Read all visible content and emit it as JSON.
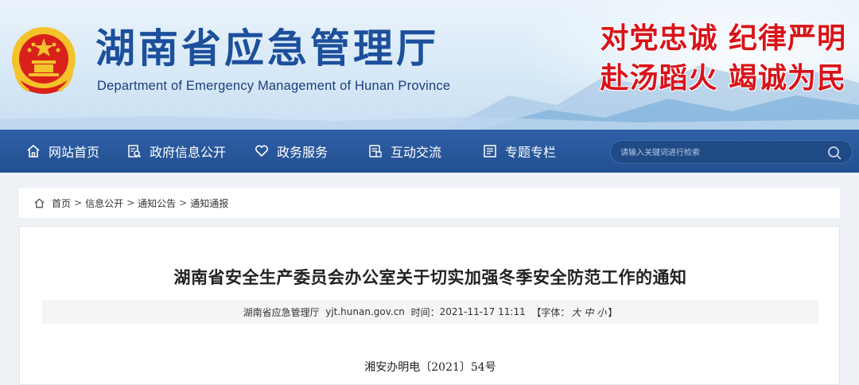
{
  "header": {
    "title": "湖南省应急管理厅",
    "subtitle": "Department of Emergency Management of Hunan Province",
    "slogan_line1": "对党忠诚 纪律严明",
    "slogan_line2": "赴汤蹈火 竭诚为民",
    "colors": {
      "title": "#1c4f9c",
      "slogan": "#d7141a",
      "nav": "#2a589d"
    }
  },
  "nav": {
    "items": [
      {
        "label": "网站首页",
        "icon": "home-icon"
      },
      {
        "label": "政府信息公开",
        "icon": "document-search-icon"
      },
      {
        "label": "政务服务",
        "icon": "heart-icon"
      },
      {
        "label": "互动交流",
        "icon": "chat-document-icon"
      },
      {
        "label": "专题专栏",
        "icon": "list-document-icon"
      }
    ],
    "search_placeholder": "请输入关键词进行检索"
  },
  "breadcrumb": {
    "items": [
      "首页",
      "信息公开",
      "通知公告",
      "通知通报"
    ],
    "separator": ">"
  },
  "article": {
    "title": "湖南省安全生产委员会办公室关于切实加强冬季安全防范工作的通知",
    "meta": {
      "source": "湖南省应急管理厅",
      "site": "yjt.hunan.gov.cn",
      "time_label": "时间：",
      "time": "2021-11-17 11:11",
      "font_label": "【字体：",
      "font_large": "大",
      "font_medium": "中",
      "font_small": "小",
      "font_close": "】"
    },
    "doc_number": "湘安办明电〔2021〕54号"
  }
}
